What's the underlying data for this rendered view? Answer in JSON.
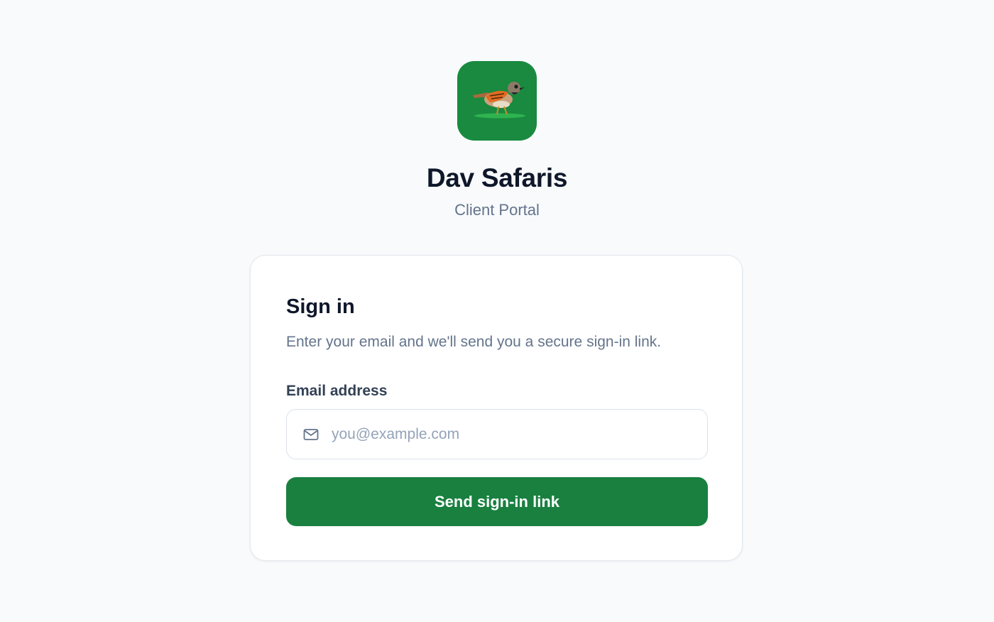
{
  "brand": {
    "logo_icon": "bird-logo-icon",
    "logo_bg_color": "#198a3f",
    "logo_text": "Dav Safaris",
    "title": "Dav Safaris",
    "subtitle": "Client Portal"
  },
  "signin": {
    "heading": "Sign in",
    "description": "Enter your email and we'll send you a secure sign-in link.",
    "email_label": "Email address",
    "email_icon": "mail-icon",
    "email_placeholder": "you@example.com",
    "email_value": "",
    "submit_label": "Send sign-in link",
    "accent_color": "#198040"
  }
}
